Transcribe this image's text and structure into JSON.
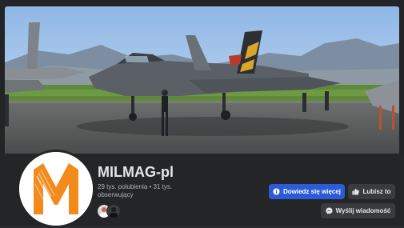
{
  "page": {
    "name": "MILMAG-pl",
    "stats_line1": "29 tys. polubienia • 31 tys.",
    "stats_line2": "obserwujący"
  },
  "buttons": {
    "learn_more": "Dowiedz się więcej",
    "like": "Lubisz to",
    "message": "Wyślij wiadomość"
  },
  "icons": {
    "learn_more": "info-icon",
    "like": "thumbs-up-icon",
    "message": "messenger-icon"
  },
  "colors": {
    "primary_button": "#2d5bd7",
    "secondary_button": "#3a3b3c",
    "logo_orange": "#f28a1c"
  }
}
